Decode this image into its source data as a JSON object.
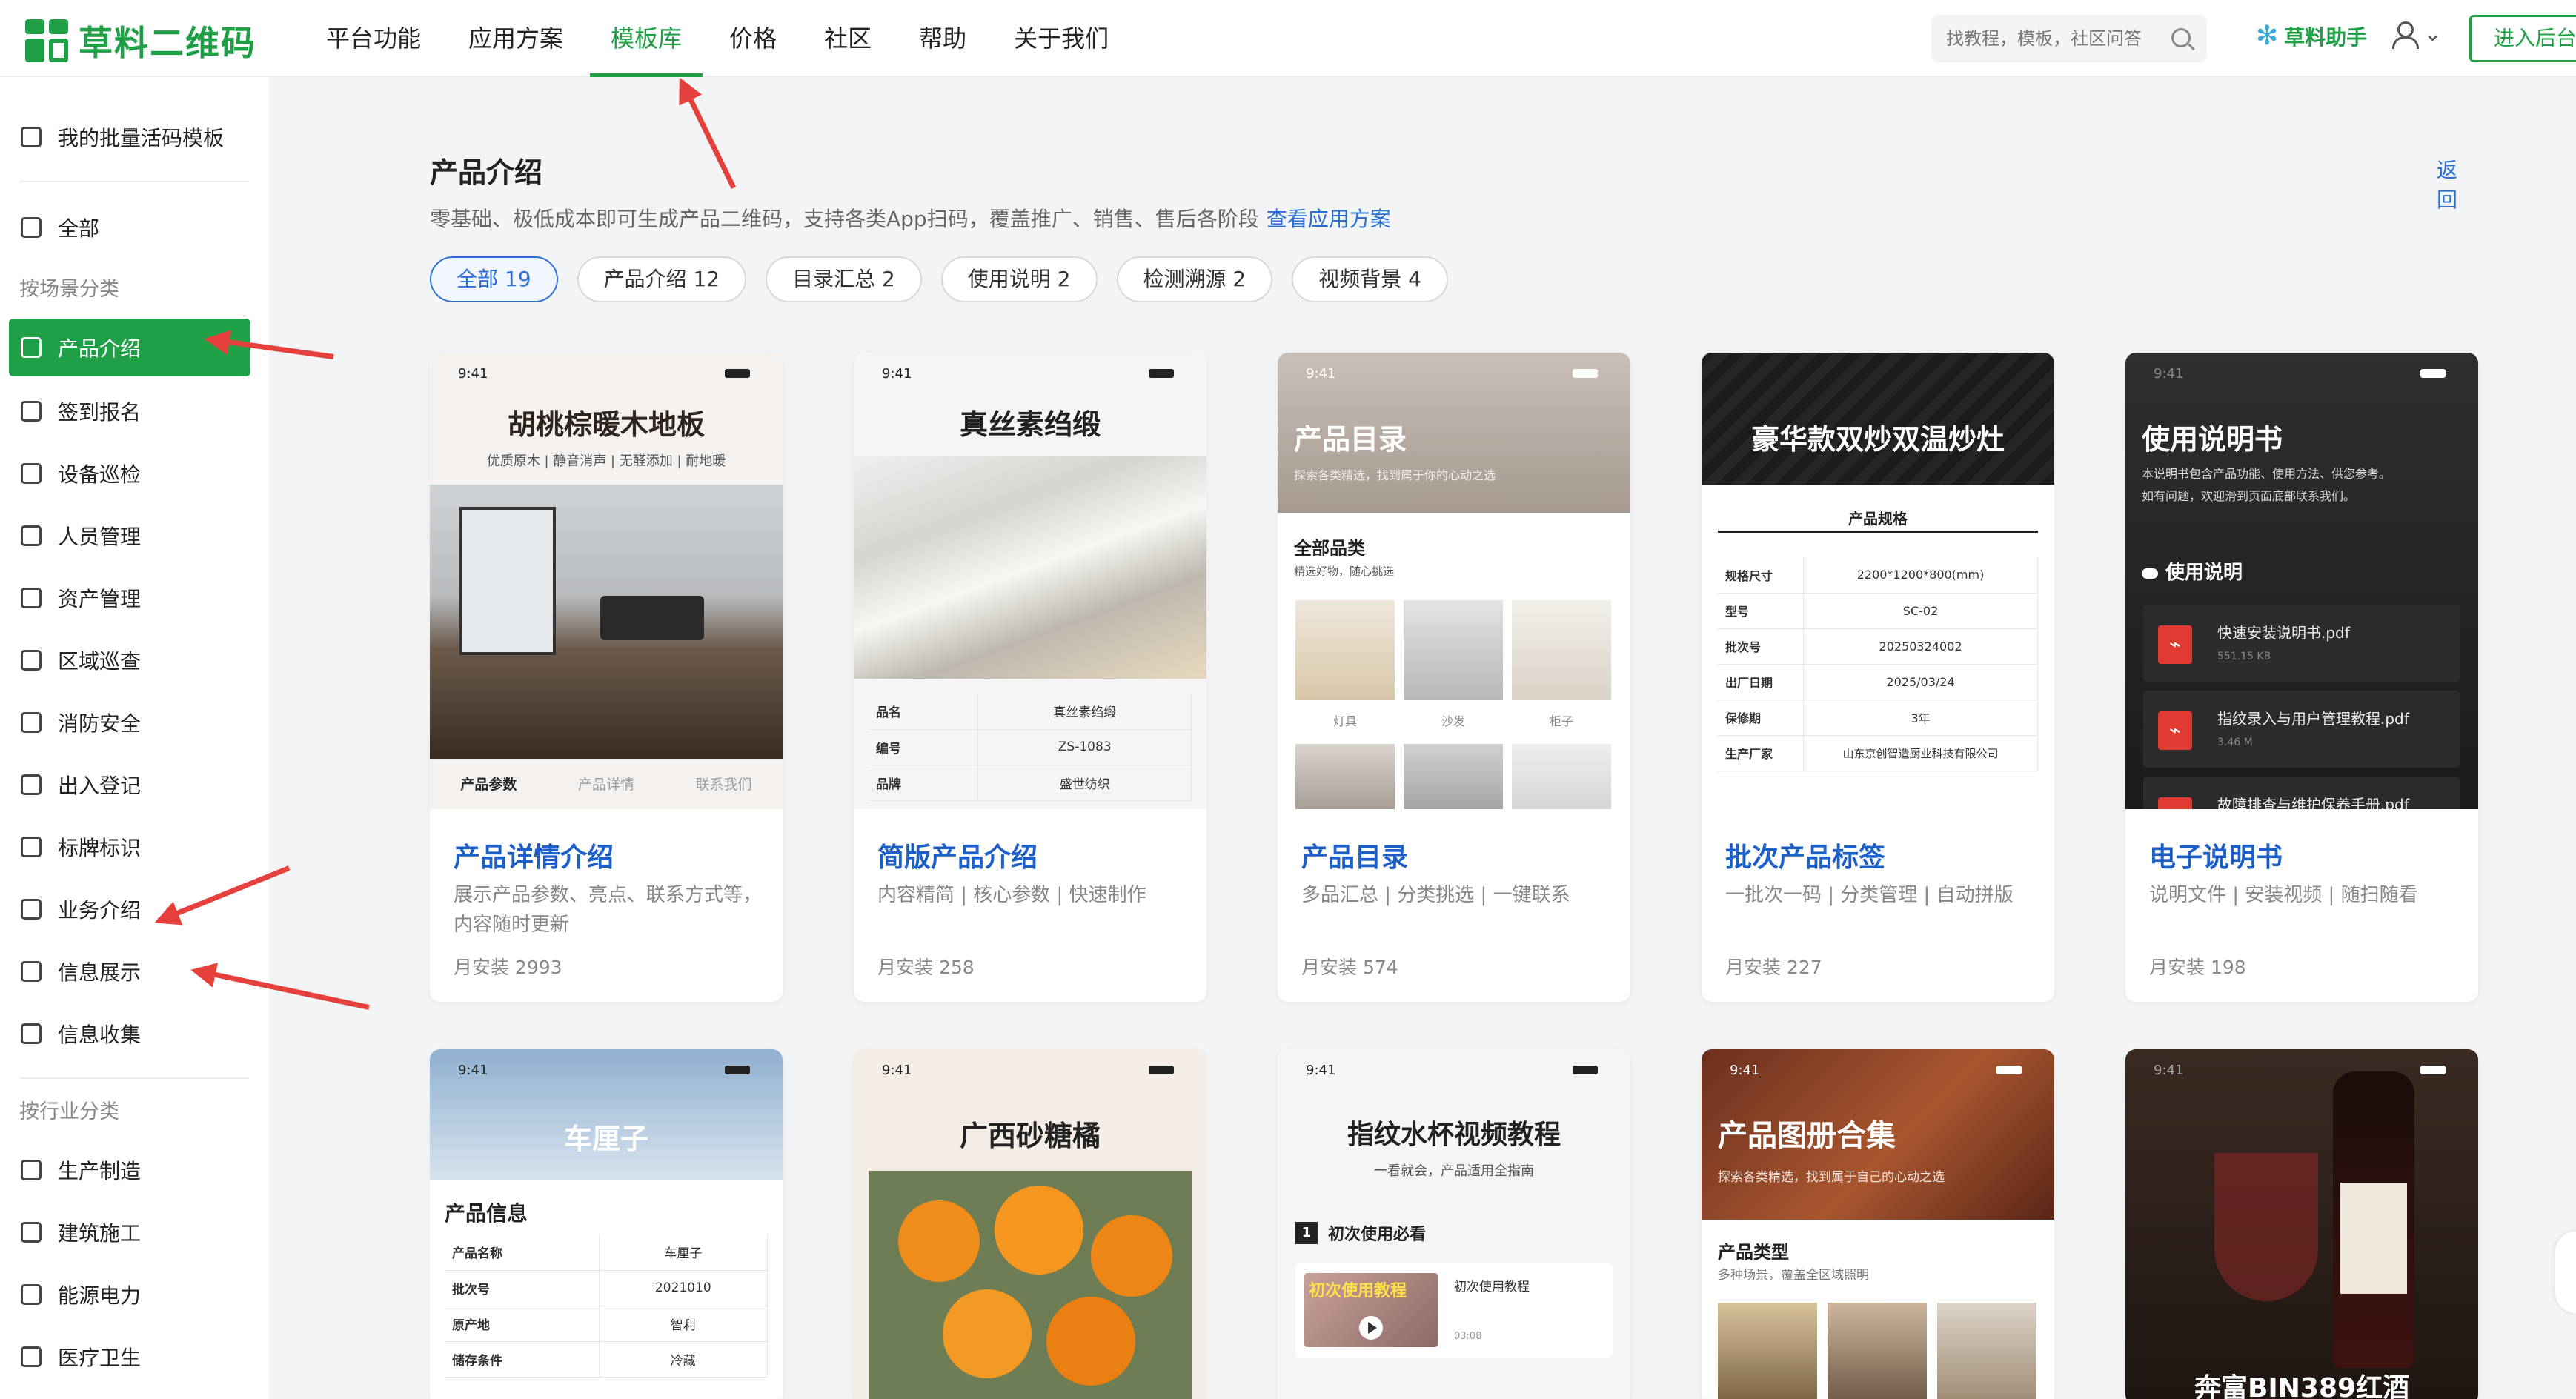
{
  "header": {
    "logo": "草料二维码",
    "nav": [
      "平台功能",
      "应用方案",
      "模板库",
      "价格",
      "社区",
      "帮助",
      "关于我们"
    ],
    "active_nav": "模板库",
    "search_placeholder": "找教程，模板，社区问答",
    "assistant": "草料助手",
    "enter_button": "进入后台"
  },
  "sidebar": {
    "my_templates": "我的批量活码模板",
    "all": "全部",
    "group_scene": "按场景分类",
    "scene_items": [
      "产品介绍",
      "签到报名",
      "设备巡检",
      "人员管理",
      "资产管理",
      "区域巡查",
      "消防安全",
      "出入登记",
      "标牌标识",
      "业务介绍",
      "信息展示",
      "信息收集"
    ],
    "active": "产品介绍",
    "group_industry": "按行业分类",
    "industry_items": [
      "生产制造",
      "建筑施工",
      "能源电力",
      "医疗卫生"
    ]
  },
  "main": {
    "title": "产品介绍",
    "back": "返回",
    "subtitle": "零基础、极低成本即可生成产品二维码，支持各类App扫码，覆盖推广、销售、售后各阶段",
    "subtitle_link": "查看应用方案",
    "filters": [
      "全部 19",
      "产品介绍 12",
      "目录汇总 2",
      "使用说明 2",
      "检测溯源 2",
      "视频背景 4"
    ],
    "active_filter": "全部 19"
  },
  "cards": [
    {
      "title": "产品详情介绍",
      "desc": "展示产品参数、亮点、联系方式等，内容随时更新",
      "installs": "月安装  2993",
      "preview": {
        "time": "9:41",
        "heading": "胡桃棕暖木地板",
        "sub": "优质原木 | 静音消声 | 无醛添加 | 耐地暖",
        "tabs": [
          "产品参数",
          "产品详情",
          "联系我们"
        ]
      }
    },
    {
      "title": "简版产品介绍",
      "desc": "内容精简 | 核心参数 | 快速制作",
      "installs": "月安装  258",
      "preview": {
        "time": "9:41",
        "heading": "真丝素绉缎",
        "rows": [
          [
            "品名",
            "真丝素绉缎"
          ],
          [
            "编号",
            "ZS-1083"
          ],
          [
            "品牌",
            "盛世纺织"
          ]
        ]
      }
    },
    {
      "title": "产品目录",
      "desc": "多品汇总 | 分类挑选 | 一键联系",
      "installs": "月安装  574",
      "preview": {
        "time": "9:41",
        "heading": "产品目录",
        "sub": "探索各类精选，找到属于你的心动之选",
        "section": "全部品类",
        "section_sub": "精选好物，随心挑选",
        "labels": [
          "灯具",
          "沙发",
          "柜子"
        ]
      }
    },
    {
      "title": "批次产品标签",
      "desc": "一批次一码 | 分类管理 | 自动拼版",
      "installs": "月安装  227",
      "preview": {
        "heading": "豪华款双炒双温炒灶",
        "section": "产品规格",
        "rows": [
          [
            "规格尺寸",
            "2200*1200*800(mm)"
          ],
          [
            "型号",
            "SC-02"
          ],
          [
            "批次号",
            "20250324002"
          ],
          [
            "出厂日期",
            "2025/03/24"
          ],
          [
            "保修期",
            "3年"
          ],
          [
            "生产厂家",
            "山东京创智造厨业科技有限公司"
          ]
        ]
      }
    },
    {
      "title": "电子说明书",
      "desc": "说明文件 | 安装视频 | 随扫随看",
      "installs": "月安装  198",
      "preview": {
        "time": "9:41",
        "heading": "使用说明书",
        "sub1": "本说明书包含产品功能、使用方法、供您参考。",
        "sub2": "如有问题，欢迎滑到页面底部联系我们。",
        "section": "使用说明",
        "files": [
          {
            "name": "快速安装说明书.pdf",
            "size": "551.15 KB"
          },
          {
            "name": "指纹录入与用户管理教程.pdf",
            "size": "3.46 M"
          },
          {
            "name": "故障排查与维护保养手册.pdf",
            "size": ""
          }
        ]
      }
    }
  ],
  "cards_row2": [
    {
      "preview": {
        "time": "9:41",
        "heading": "车厘子",
        "section": "产品信息",
        "rows": [
          [
            "产品名称",
            "车厘子"
          ],
          [
            "批次号",
            "2021010"
          ],
          [
            "原产地",
            "智利"
          ],
          [
            "储存条件",
            "冷藏"
          ]
        ]
      }
    },
    {
      "preview": {
        "time": "9:41",
        "heading": "广西砂糖橘"
      }
    },
    {
      "preview": {
        "time": "9:41",
        "heading": "指纹水杯视频教程",
        "sub": "一看就会，产品适用全指南",
        "step_num": "1",
        "step": "初次使用必看",
        "video_label": "初次使用教程",
        "video_title": "初次使用教程",
        "video_time": "03:08"
      }
    },
    {
      "preview": {
        "time": "9:41",
        "heading": "产品图册合集",
        "sub": "探索各类精选，找到属于自己的心动之选",
        "section": "产品类型",
        "section_sub": "多种场景，覆盖全区域照明"
      }
    },
    {
      "preview": {
        "time": "9:41",
        "heading": "奔富BIN389红酒"
      }
    }
  ],
  "colors": {
    "brand": "#1fa046",
    "link": "#2b6fd6",
    "arrow": "#e5403b"
  }
}
